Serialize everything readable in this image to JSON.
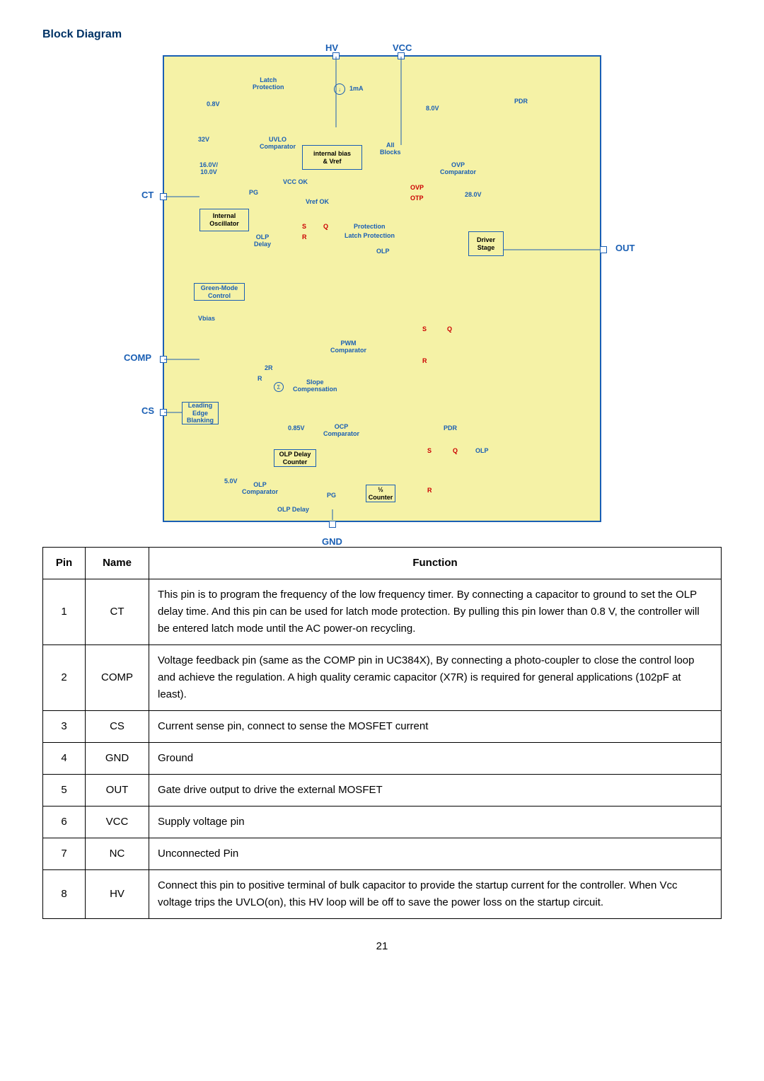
{
  "title": "Block Diagram",
  "diagram": {
    "pins": {
      "HV": "HV",
      "VCC": "VCC",
      "CT": "CT",
      "COMP": "COMP",
      "CS": "CS",
      "OUT": "OUT",
      "GND": "GND"
    },
    "labels": {
      "latch_protection": "Latch\nProtection",
      "0_8v": "0.8V",
      "1ma": "1mA",
      "8_0v": "8.0V",
      "PDR": "PDR",
      "32V": "32V",
      "16_0v_10_0v": "16.0V/\n10.0V",
      "UVLO_comp": "UVLO\nComparator",
      "internal_bias": "internal bias\n& Vref",
      "all_blocks": "All\nBlocks",
      "OVP_comp": "OVP\nComparator",
      "VCC_OK": "VCC OK",
      "OVP": "OVP",
      "OTP": "OTP",
      "28_0v": "28.0V",
      "PG": "PG",
      "Vref_OK": "Vref OK",
      "internal_osc": "Internal\nOscillator",
      "OLP_delay": "OLP\nDelay",
      "S": "S",
      "Q": "Q",
      "R": "R",
      "protection": "Protection",
      "latch_prot": "Latch Protection",
      "OLP": "OLP",
      "driver_stage": "Driver\nStage",
      "green_mode": "Green-Mode\nControl",
      "Vbias": "Vbias",
      "PWM_comp": "PWM\nComparator",
      "2R": "2R",
      "Rlbl": "R",
      "slope_comp": "Slope\nCompensation",
      "sigma": "Σ",
      "LEB": "Leading\nEdge\nBlanking",
      "0_85v": "0.85V",
      "OCP_comp": "OCP\nComparator",
      "OLP_delay_counter": "OLP Delay\nCounter",
      "5_0v": "5.0V",
      "OLP_comp": "OLP\nComparator",
      "OLP_Delay": "OLP Delay",
      "half_counter": "½\nCounter",
      "PDR2": "PDR"
    }
  },
  "table": {
    "headers": {
      "pin": "Pin",
      "name": "Name",
      "function": "Function"
    },
    "rows": [
      {
        "pin": "1",
        "name": "CT",
        "function": "This pin is to program the frequency of the low frequency timer. By connecting a capacitor to ground to set the OLP delay time. And this pin can be used for latch mode protection. By pulling this pin lower than 0.8 V, the controller will be entered latch mode until the AC power-on recycling."
      },
      {
        "pin": "2",
        "name": "COMP",
        "function": "Voltage feedback pin (same as the COMP pin in UC384X), By connecting a photo-coupler to close the control loop and achieve the regulation. A high quality ceramic capacitor (X7R) is required for general applications (102pF at least)."
      },
      {
        "pin": "3",
        "name": "CS",
        "function": "Current sense pin, connect to sense the MOSFET current"
      },
      {
        "pin": "4",
        "name": "GND",
        "function": "Ground"
      },
      {
        "pin": "5",
        "name": "OUT",
        "function": "Gate drive output to drive the external MOSFET"
      },
      {
        "pin": "6",
        "name": "VCC",
        "function": "Supply voltage pin"
      },
      {
        "pin": "7",
        "name": "NC",
        "function": "Unconnected Pin"
      },
      {
        "pin": "8",
        "name": "HV",
        "function": "Connect this pin to positive terminal of bulk capacitor to provide the startup current for the controller. When Vcc voltage trips the UVLO(on), this HV loop will be off to save the power loss on the startup circuit."
      }
    ]
  },
  "page_number": "21"
}
